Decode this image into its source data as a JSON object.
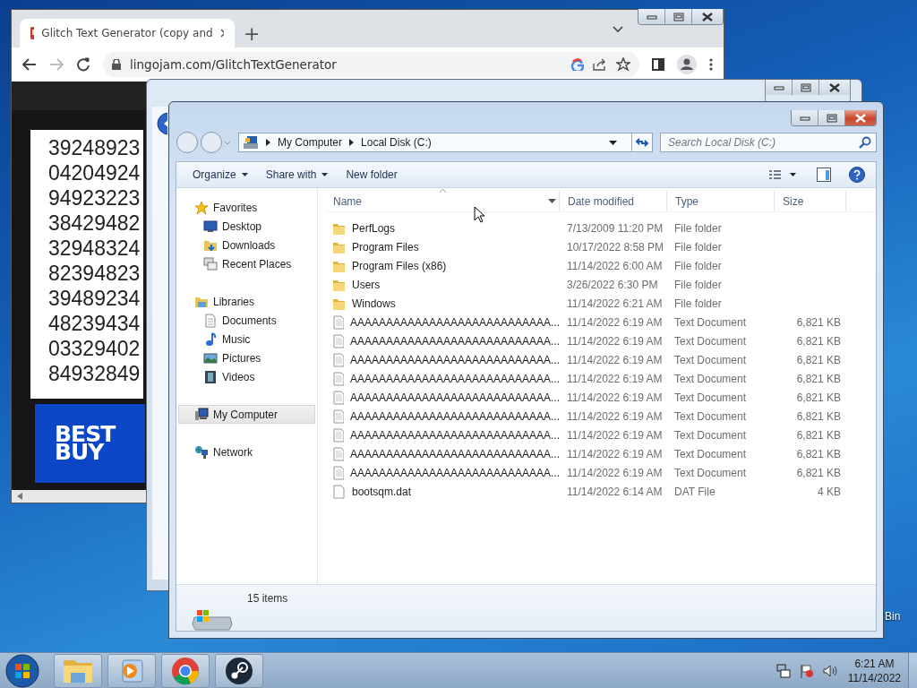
{
  "browser": {
    "tabs": [
      {
        "title": "Glitch Text Generator (copy and",
        "selected": true
      }
    ],
    "new_tab": "+",
    "url": "lingojam.com/GlitchTextGenerator",
    "numbers": [
      "39248923",
      "04204924",
      "94923223",
      "38429482",
      "32948324",
      "82394823",
      "39489234",
      "48239434",
      "03329402",
      "84932849"
    ],
    "ad": {
      "line_1": "BEST",
      "line_2": "BUY"
    }
  },
  "explorer": {
    "breadcrumb": [
      "My Computer",
      "Local Disk (C:)"
    ],
    "search": {
      "placeholder": "Search Local Disk (C:)"
    },
    "toolbar": [
      {
        "label": "Organize",
        "menu": true
      },
      {
        "label": "Share with",
        "menu": true
      },
      {
        "label": "New folder",
        "menu": false
      }
    ],
    "nav": [
      {
        "label": "Favorites",
        "kind": "favorites",
        "selected": false,
        "children": [
          {
            "label": "Desktop",
            "kind": "desktop",
            "selected": false
          },
          {
            "label": "Downloads",
            "kind": "downloads",
            "selected": false
          },
          {
            "label": "Recent Places",
            "kind": "recent",
            "selected": false
          }
        ]
      },
      {
        "label": "Libraries",
        "kind": "libraries",
        "selected": false,
        "children": [
          {
            "label": "Documents",
            "kind": "documents",
            "selected": false
          },
          {
            "label": "Music",
            "kind": "music",
            "selected": false
          },
          {
            "label": "Pictures",
            "kind": "pictures",
            "selected": false
          },
          {
            "label": "Videos",
            "kind": "videos",
            "selected": false
          }
        ]
      },
      {
        "label": "My Computer",
        "kind": "computer",
        "selected": true
      },
      {
        "label": "Network",
        "kind": "network",
        "selected": false
      }
    ],
    "columns": [
      "Name",
      "Date modified",
      "Type",
      "Size"
    ],
    "rows": [
      {
        "name": "PerfLogs",
        "date": "7/13/2009 11:20 PM",
        "type": "File folder",
        "kind": "folder"
      },
      {
        "name": "Program Files",
        "date": "10/17/2022 8:58 PM",
        "type": "File folder",
        "kind": "folder"
      },
      {
        "name": "Program Files (x86)",
        "date": "11/14/2022 6:00 AM",
        "type": "File folder",
        "kind": "folder"
      },
      {
        "name": "Users",
        "date": "3/26/2022 6:30 PM",
        "type": "File folder",
        "kind": "folder"
      },
      {
        "name": "Windows",
        "date": "11/14/2022 6:21 AM",
        "type": "File folder",
        "kind": "folder"
      },
      {
        "name": "AAAAAAAAAAAAAAAAAAAAAAAAAAAA...",
        "date": "11/14/2022 6:19 AM",
        "type": "Text Document",
        "size": "6,821 KB",
        "kind": "text"
      },
      {
        "name": "AAAAAAAAAAAAAAAAAAAAAAAAAAAA...",
        "date": "11/14/2022 6:19 AM",
        "type": "Text Document",
        "size": "6,821 KB",
        "kind": "text"
      },
      {
        "name": "AAAAAAAAAAAAAAAAAAAAAAAAAAAA...",
        "date": "11/14/2022 6:19 AM",
        "type": "Text Document",
        "size": "6,821 KB",
        "kind": "text"
      },
      {
        "name": "AAAAAAAAAAAAAAAAAAAAAAAAAAAA...",
        "date": "11/14/2022 6:19 AM",
        "type": "Text Document",
        "size": "6,821 KB",
        "kind": "text"
      },
      {
        "name": "AAAAAAAAAAAAAAAAAAAAAAAAAAAA...",
        "date": "11/14/2022 6:19 AM",
        "type": "Text Document",
        "size": "6,821 KB",
        "kind": "text"
      },
      {
        "name": "AAAAAAAAAAAAAAAAAAAAAAAAAAAA...",
        "date": "11/14/2022 6:19 AM",
        "type": "Text Document",
        "size": "6,821 KB",
        "kind": "text"
      },
      {
        "name": "AAAAAAAAAAAAAAAAAAAAAAAAAAAA...",
        "date": "11/14/2022 6:19 AM",
        "type": "Text Document",
        "size": "6,821 KB",
        "kind": "text"
      },
      {
        "name": "AAAAAAAAAAAAAAAAAAAAAAAAAAAA...",
        "date": "11/14/2022 6:19 AM",
        "type": "Text Document",
        "size": "6,821 KB",
        "kind": "text"
      },
      {
        "name": "AAAAAAAAAAAAAAAAAAAAAAAAAAAA...",
        "date": "11/14/2022 6:19 AM",
        "type": "Text Document",
        "size": "6,821 KB",
        "kind": "text"
      },
      {
        "name": "bootsqm.dat",
        "date": "11/14/2022 6:14 AM",
        "type": "DAT File",
        "size": "4 KB",
        "kind": "file"
      }
    ],
    "status": "15 items"
  },
  "desktop": {
    "icons": [
      {
        "label": "Bin"
      }
    ]
  },
  "taskbar": {
    "apps": [
      {
        "kind": "explorer"
      },
      {
        "kind": "media"
      },
      {
        "kind": "chrome"
      },
      {
        "kind": "steam"
      }
    ],
    "clock": {
      "time": "6:21 AM",
      "date": "11/14/2022"
    }
  }
}
